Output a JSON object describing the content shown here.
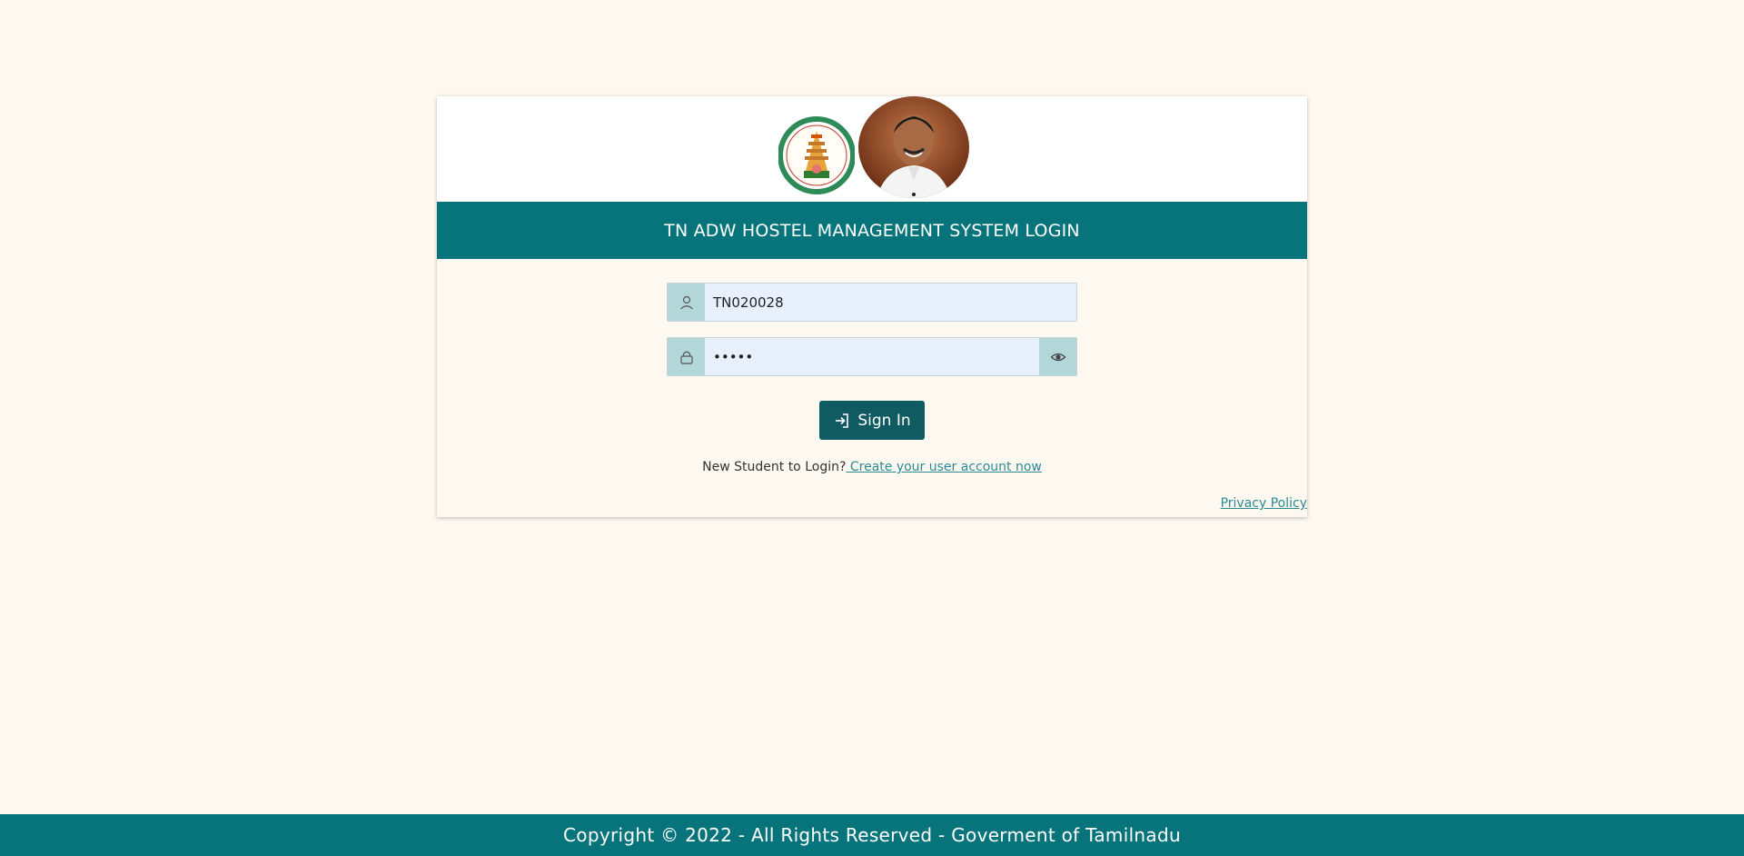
{
  "header": {
    "title": "TN ADW HOSTEL MANAGEMENT SYSTEM LOGIN"
  },
  "login": {
    "username_value": "TN020028",
    "password_value": "•••••",
    "sign_in_label": "Sign In"
  },
  "signup": {
    "prompt": "New Student to Login?",
    "link": " Create your user account now"
  },
  "links": {
    "privacy": "Privacy Policy"
  },
  "footer": {
    "copyright": "Copyright © 2022 - All Rights Reserved - Goverment of Tamilnadu"
  },
  "icons": {
    "user": "user-icon",
    "lock": "lock-icon",
    "eye": "eye-icon",
    "signin": "sign-in-icon"
  },
  "colors": {
    "page_bg": "#fdf8f0",
    "brand_teal": "#07747b",
    "button": "#0f5b61",
    "link": "#2b8a93",
    "input_bg": "#e8f0fe",
    "addon_bg": "#b3d6d9"
  }
}
